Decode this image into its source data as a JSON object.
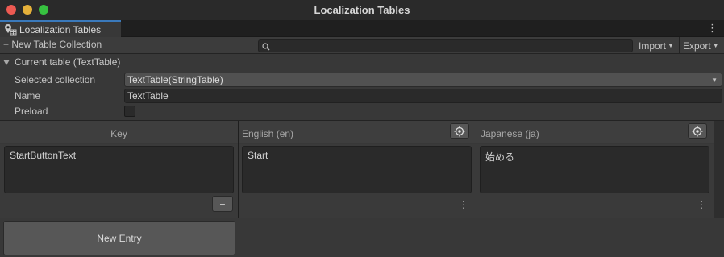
{
  "window": {
    "title": "Localization Tables"
  },
  "tab": {
    "label": "Localization Tables",
    "icon": "localization-map-icon"
  },
  "toolbar": {
    "new_collection_label": "+ New Table Collection",
    "search_value": "",
    "import_label": "Import",
    "export_label": "Export"
  },
  "current_table": {
    "foldout_label": "Current table (TextTable)",
    "selected_collection_label": "Selected collection",
    "selected_collection_value": "TextTable(StringTable)",
    "name_label": "Name",
    "name_value": "TextTable",
    "preload_label": "Preload",
    "preload_checked": false
  },
  "table": {
    "columns": [
      {
        "header": "Key"
      },
      {
        "header": "English (en)"
      },
      {
        "header": "Japanese (ja)"
      }
    ],
    "rows": [
      {
        "key": "StartButtonText",
        "en": "Start",
        "ja": "始める"
      }
    ]
  },
  "footer": {
    "new_entry_label": "New Entry"
  },
  "colors": {
    "accent": "#3a79bb",
    "background": "#383838",
    "field": "#2a2a2a"
  }
}
